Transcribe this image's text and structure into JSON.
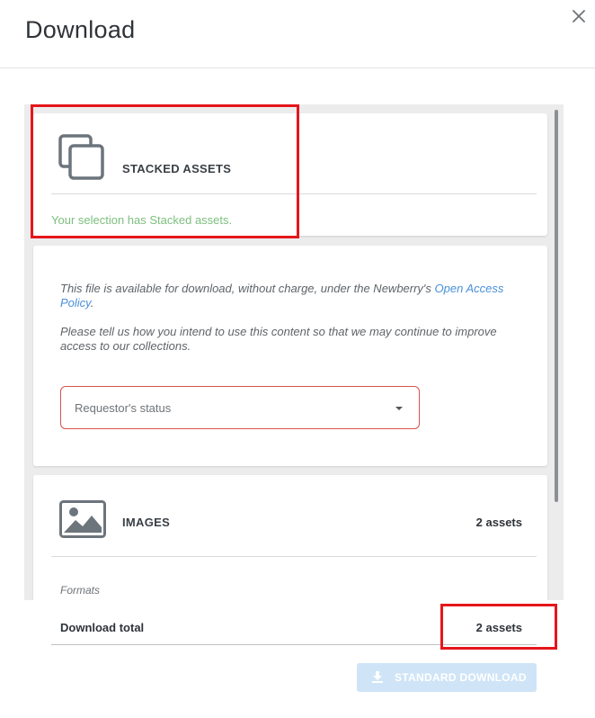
{
  "dialog": {
    "title": "Download",
    "close_icon": "close-icon"
  },
  "stacked_card": {
    "icon": "stacked-assets-icon",
    "label": "STACKED ASSETS",
    "message": "Your selection has Stacked assets."
  },
  "policy_card": {
    "text_before_link": "This file is available for download, without charge, under the Newberry's ",
    "link_text": "Open Access Policy",
    "text_after_link": ".",
    "intent_text": "Please tell us how you intend to use this content so that we may continue to improve access to our collections.",
    "requestor_select": {
      "placeholder": "Requestor's status",
      "caret_icon": "caret-down-icon"
    }
  },
  "images_card": {
    "icon": "image-icon",
    "label": "IMAGES",
    "count": "2 assets",
    "formats_label": "Formats"
  },
  "total": {
    "label": "Download total",
    "count": "2 assets"
  },
  "download_button": {
    "icon": "download-icon",
    "label": "STANDARD DOWNLOAD"
  },
  "colors": {
    "highlight": "#e5161b",
    "success_text": "#7dbf7f",
    "link": "#4a90d9",
    "select_border": "#d9534f",
    "button_disabled": "#cfe4f7"
  }
}
